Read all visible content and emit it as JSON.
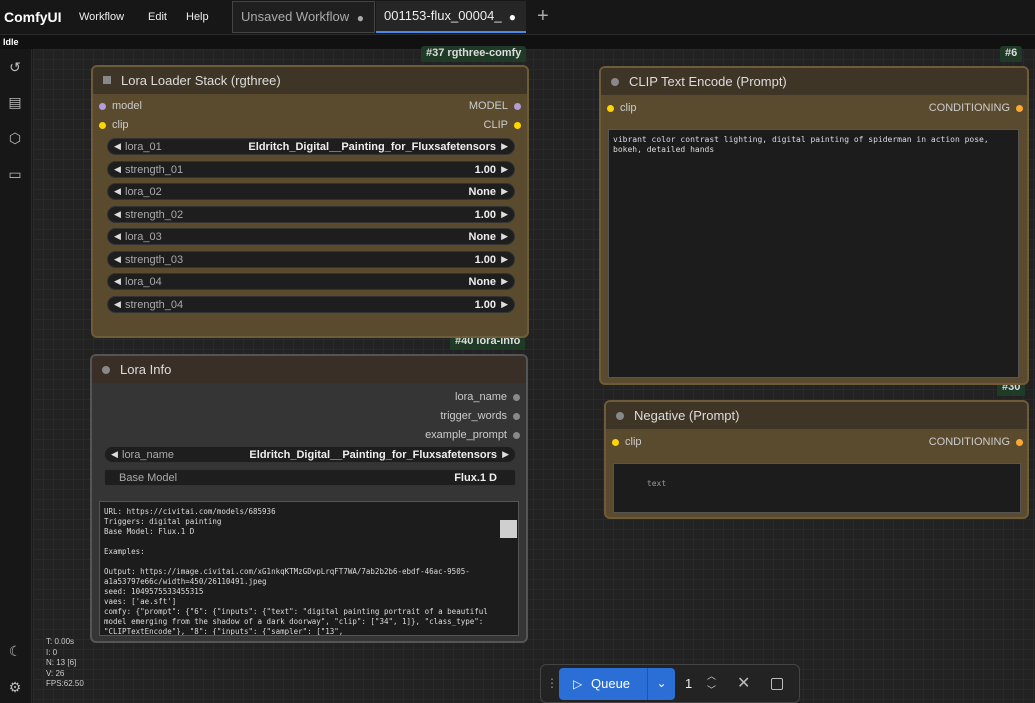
{
  "app": {
    "logo": "ComfyUI",
    "menu": [
      "Workflow",
      "Edit",
      "Help"
    ]
  },
  "tabs": [
    {
      "label": "Unsaved Workflow",
      "dot": "●"
    },
    {
      "label": "001153-flux_00004_",
      "dot": "●"
    }
  ],
  "status": "Idle",
  "sidebar_icons": [
    "history-icon",
    "document-icon",
    "cube-icon",
    "folder-icon",
    "moon-icon",
    "gear-icon"
  ],
  "badges": {
    "b37": "#37 rgthree-comfy",
    "b6": "#6",
    "b40": "#40 lora-info",
    "b30": "#30"
  },
  "lora_stack": {
    "title": "Lora Loader Stack (rgthree)",
    "in_model": "model",
    "in_clip": "clip",
    "out_model": "MODEL",
    "out_clip": "CLIP",
    "widgets": [
      {
        "label": "lora_01",
        "value": "Eldritch_Digital__Painting_for_Fluxsafetensors"
      },
      {
        "label": "strength_01",
        "value": "1.00"
      },
      {
        "label": "lora_02",
        "value": "None"
      },
      {
        "label": "strength_02",
        "value": "1.00"
      },
      {
        "label": "lora_03",
        "value": "None"
      },
      {
        "label": "strength_03",
        "value": "1.00"
      },
      {
        "label": "lora_04",
        "value": "None"
      },
      {
        "label": "strength_04",
        "value": "1.00"
      }
    ]
  },
  "lora_info": {
    "title": "Lora Info",
    "outputs": [
      "lora_name",
      "trigger_words",
      "example_prompt"
    ],
    "w1_label": "lora_name",
    "w1_value": "Eldritch_Digital__Painting_for_Fluxsafetensors",
    "w2_label": "Base Model",
    "w2_value": "Flux.1 D",
    "text": "URL: https://civitai.com/models/685936\nTriggers: digital painting\nBase Model: Flux.1 D\n\nExamples:\n\nOutput: https://image.civitai.com/xG1nkqKTMzGDvpLrqFT7WA/7ab2b2b6-ebdf-46ac-9505-a1a53797e66c/width=450/26110491.jpeg\nseed: 1049575533455315\nvaes: ['ae.sft']\ncomfy: {\"prompt\": {\"6\": {\"inputs\": {\"text\": \"digital painting portrait of a beautiful model emerging from the shadow of a dark doorway\", \"clip\": [\"34\", 1]}, \"class_type\": \"CLIPTextEncode\"}, \"8\": {\"inputs\": {\"sampler\": [\"13\","
  },
  "clip_encode": {
    "title": "CLIP Text Encode (Prompt)",
    "in_clip": "clip",
    "out": "CONDITIONING",
    "text": "vibrant color contrast lighting, digital painting of spiderman in action pose, bokeh, detailed hands"
  },
  "negative": {
    "title": "Negative (Prompt)",
    "in_clip": "clip",
    "out": "CONDITIONING",
    "placeholder": "text"
  },
  "stats": [
    "T: 0.00s",
    "I: 0",
    "N: 13 [6]",
    "V: 26",
    "FPS:62.50"
  ],
  "queue": {
    "label": "Queue",
    "count": "1"
  },
  "colors": {
    "accent": "#2b6ed6",
    "node_brown": "#5a4b2f",
    "slot_yellow": "#ffd500",
    "slot_purple": "#b39ddb",
    "slot_orange": "#ffa931"
  }
}
